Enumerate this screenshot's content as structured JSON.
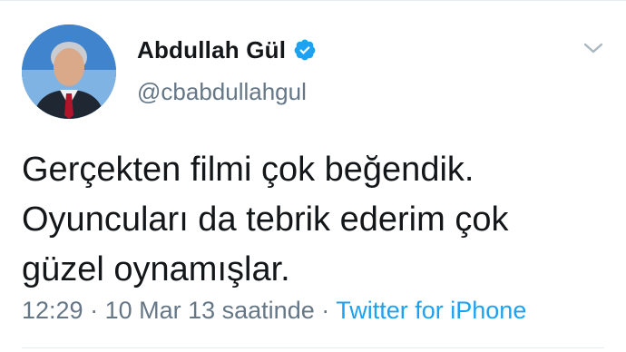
{
  "author": {
    "display_name": "Abdullah Gül",
    "handle": "@cbabdullahgul",
    "verified": true
  },
  "tweet": {
    "text": "Gerçekten filmi çok beğendik.\nOyuncuları da tebrik ederim çok\ngüzel oynamışlar.",
    "time": "12:29",
    "separator_1": " · ",
    "date": "10 Mar 13 saatinde",
    "separator_2": " · ",
    "source": "Twitter for iPhone"
  },
  "icons": {
    "verified": "verified-badge-icon",
    "menu": "chevron-down-icon"
  },
  "colors": {
    "text_primary": "#14171a",
    "text_secondary": "#657786",
    "accent": "#1da1f2"
  }
}
